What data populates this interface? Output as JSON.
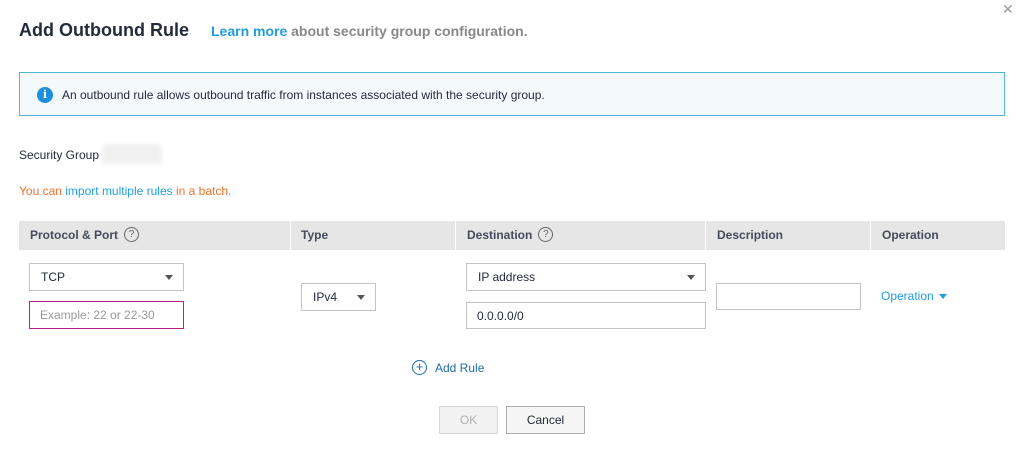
{
  "dialog": {
    "title": "Add Outbound Rule",
    "learn_more": "Learn more",
    "learn_more_suffix": " about security group configuration.",
    "close_glyph": "✕"
  },
  "banner": {
    "icon": "info-icon",
    "icon_glyph": "i",
    "text": "An outbound rule allows outbound traffic from instances associated with the security group."
  },
  "security_group": {
    "label": "Security Group",
    "value": ""
  },
  "batch": {
    "prefix": "You can ",
    "link": "import multiple rules",
    "suffix": " in a batch."
  },
  "table": {
    "headers": {
      "protocol_port": "Protocol & Port",
      "type": "Type",
      "destination": "Destination",
      "description": "Description",
      "operation": "Operation"
    },
    "help_glyph": "?",
    "row": {
      "protocol": "TCP",
      "port_value": "",
      "port_placeholder": "Example: 22 or 22-30",
      "type": "IPv4",
      "destination_type": "IP address",
      "destination_value": "0.0.0.0/0",
      "description_value": "",
      "operation": "Operation"
    }
  },
  "add_rule": {
    "icon_glyph": "+",
    "label": "Add Rule"
  },
  "buttons": {
    "ok": "OK",
    "cancel": "Cancel"
  },
  "colors": {
    "accent_link": "#1f9ede",
    "warning_text": "#f66f29",
    "banner_border": "#4fb8d6",
    "error_border": "#b91d8a"
  }
}
